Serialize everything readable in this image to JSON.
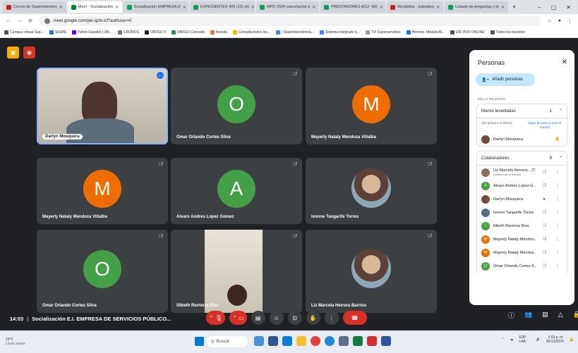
{
  "browser": {
    "tabs": [
      {
        "label": "Correo de Superintenden",
        "color": "#c5221f",
        "active": false
      },
      {
        "label": "Meet - Socialización",
        "color": "#00832d",
        "active": true
      },
      {
        "label": "Socialización EMPRESA D",
        "color": "#0f9d58",
        "active": false
      },
      {
        "label": "EXPEDIENTES 420 (13).xls",
        "color": "#0f9d58",
        "active": false
      },
      {
        "label": "MPD 2024 cancelación d",
        "color": "#0f9d58",
        "active": false
      },
      {
        "label": "PRESTADORES ACU -NO",
        "color": "#0f9d58",
        "active": false
      },
      {
        "label": "Recibidos - subsidios",
        "color": "#c5221f",
        "active": false
      },
      {
        "label": "Listado de preguntas y te",
        "color": "#0f9d58",
        "active": false
      }
    ],
    "url": "meet.google.com/pei-qztb-icf?authuser=0",
    "bookmarks": [
      "Campus virtual Sup...",
      "SIGME",
      "Yahoo Español | Últi...",
      "CRONOS",
      "ORFEO II",
      "ORFEO Consulta",
      "Aranda",
      "Consulta todos los...",
      "| Superintendencia...",
      "Sistema integrado d...",
      "TVI Superservicios",
      "Hermes- Módulo Al...",
      "EN VIVO ONLINE",
      "Todos los favoritos"
    ]
  },
  "tiles": [
    {
      "name": "Darlyn Mosquera",
      "type": "video"
    },
    {
      "name": "Omar Orlando Cortes Silva",
      "type": "avatar",
      "initial": "O",
      "color": "#43a047"
    },
    {
      "name": "Mayerly Nataly Mendoza Villalba",
      "type": "avatar",
      "initial": "M",
      "color": "#ef6c00"
    },
    {
      "name": "Mayerly Nataly Mendoza Villalba",
      "type": "avatar",
      "initial": "M",
      "color": "#ef6c00"
    },
    {
      "name": "Alvaro Andres Lopez Gomez",
      "type": "avatar",
      "initial": "A",
      "color": "#43a047"
    },
    {
      "name": "Ivonne Tangarife Torres",
      "type": "photo"
    },
    {
      "name": "Omar Orlando Cortes Silva",
      "type": "avatar",
      "initial": "O",
      "color": "#43a047"
    },
    {
      "name": "lilibeth Renteria Rios",
      "type": "video"
    },
    {
      "name": "Liz Marcela Herrera Barrios",
      "type": "photo"
    }
  ],
  "meeting": {
    "time": "14:03",
    "title": "Socialización E.I. EMPRESA DE SERVICIOS PÚBLICO..."
  },
  "panel": {
    "title": "Personas",
    "add_label": "Añadir personas",
    "section_label": "EN LA REUNIÓN",
    "raised": {
      "label": "Manos levantadas",
      "count": "1",
      "order_label": "(del primero al último)",
      "lower_all": "Bajar la mano a todo el mundo",
      "person": "Darlyn Mosquera"
    },
    "collab": {
      "label": "Colaboradores",
      "count": "9",
      "people": [
        {
          "name": "Liz Marcela Herrera... (Tú)",
          "sub": "Anfitrión de la reunión",
          "color": "#8d6e63",
          "initial": ""
        },
        {
          "name": "Alvaro Andres Lopez G...",
          "sub": "",
          "color": "#43a047",
          "initial": "A"
        },
        {
          "name": "Darlyn Mosquera",
          "sub": "",
          "color": "#6d4c41",
          "initial": ""
        },
        {
          "name": "Ivonne Tangarife Torres",
          "sub": "",
          "color": "#546e7a",
          "initial": ""
        },
        {
          "name": "lilibeth Renteria Rios",
          "sub": "",
          "color": "#43a047",
          "initial": "l"
        },
        {
          "name": "Mayerly Nataly Mendoz...",
          "sub": "",
          "color": "#ef6c00",
          "initial": "M"
        },
        {
          "name": "Mayerly Nataly Mendoz...",
          "sub": "",
          "color": "#ef6c00",
          "initial": "M"
        },
        {
          "name": "Omar Orlando Cortes S...",
          "sub": "",
          "color": "#43a047",
          "initial": "O"
        }
      ]
    }
  },
  "taskbar": {
    "temp": "19°C",
    "weather": "Lluvia suave",
    "search": "Buscar",
    "lang": "ESP LAA",
    "time": "2:03 p. m.",
    "date": "30/12/2024"
  }
}
